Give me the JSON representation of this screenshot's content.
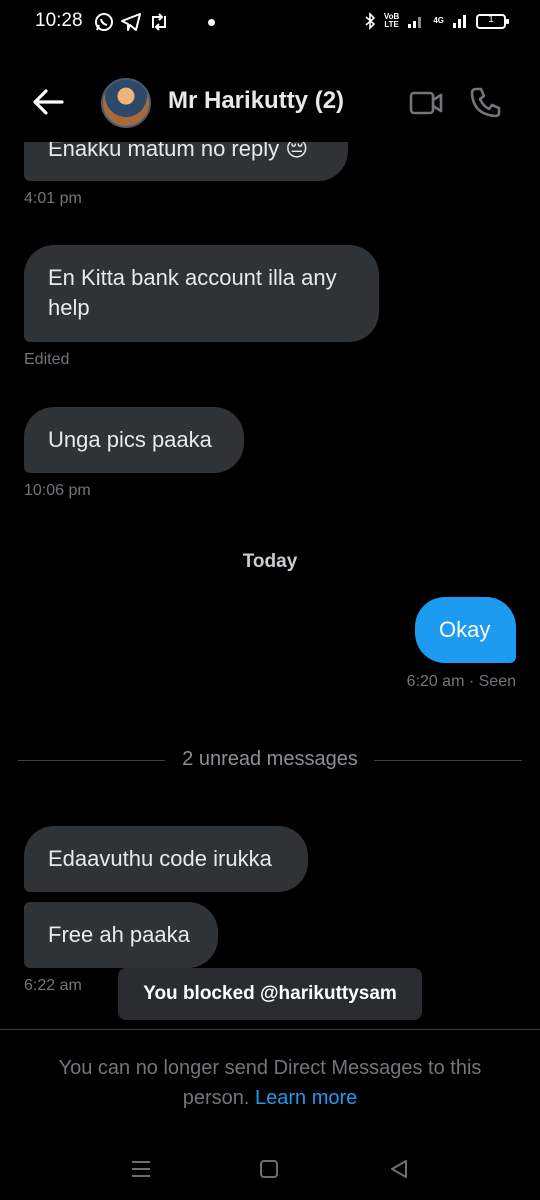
{
  "status_bar": {
    "time": "10:28",
    "network_label_1": "VoB",
    "network_label_2": "LTE",
    "signal_label": "4G",
    "battery_level": "1"
  },
  "header": {
    "title": "Mr Harikutty (2)",
    "back_icon": "arrow-left-icon",
    "video_icon": "video-camera-icon",
    "call_icon": "phone-icon"
  },
  "messages": [
    {
      "text": "Enakku matum no reply 😔",
      "meta": "4:01 pm"
    },
    {
      "text": "En Kitta bank account illa any help",
      "meta": "Edited"
    },
    {
      "text": "Unga pics paaka",
      "meta": "10:06 pm"
    }
  ],
  "day_separator": "Today",
  "outgoing": {
    "text": "Okay",
    "meta": "6:20 am · Seen"
  },
  "unread_label": "2 unread messages",
  "new_messages": [
    {
      "text": "Edaavuthu code irukka"
    },
    {
      "text": "Free ah paaka"
    }
  ],
  "new_messages_meta": "6:22 am",
  "toast": "You blocked @harikuttysam",
  "footer": {
    "note": "You can no longer send Direct Messages to this person.",
    "link": "Learn more"
  },
  "colors": {
    "accent": "#1d9bf0",
    "bubble": "#2f3336",
    "background": "#000000"
  }
}
